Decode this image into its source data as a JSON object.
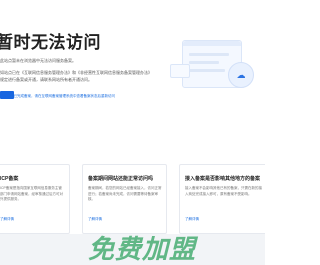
{
  "hero": {
    "title": "暂时无法访问",
    "line1": "此站点暂未在浏览器中无法访问服务备案。",
    "line2": "如站点已在《互联网信息服务管理办法》和《非经营性互联网信息服务备案管理办法》",
    "line3": "规定进行备案或开通，请联系网站所有者开通访问。",
    "note": "如已完成备案，请在互联网备案管理系统中查看备案状态后重新访问"
  },
  "cards": [
    {
      "title": "ICP备案",
      "text": "ICP备案是指向国家互联网信息服务主管部门申请网站备案，经审核通过后方可对外提供服务。",
      "link": "了解详情"
    },
    {
      "title": "备案期间网站还能正常访问吗",
      "text": "备案期间，若您的网站已经备案接入，访问正常进行；若备案尚未完成，访问需要等待备案审核。",
      "link": "了解详情"
    },
    {
      "title": "接入备案是否影响其他地方的备案",
      "text": "接入备案不会影响其他已有的备案，只需在新的接入商处完成接入即可，原有备案不受影响。",
      "link": "了解详情"
    }
  ],
  "watermark": "免费加盟",
  "colors": {
    "accent": "#1765e0",
    "watermark": "#28a05a"
  }
}
